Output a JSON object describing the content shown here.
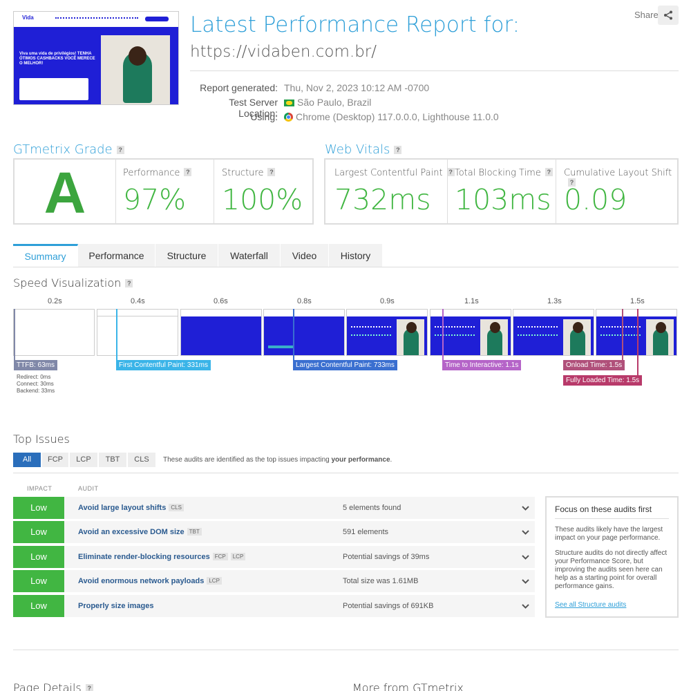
{
  "header": {
    "title": "Latest Performance Report for:",
    "url": "https://vidaben.com.br/",
    "share_label": "Share",
    "share_icon": "share-icon"
  },
  "thumbnail": {
    "logo": "Vida",
    "hero_text": "Viva uma vida de privilégios! TENHA ÓTIMOS CASHBACKS VOCÊ MERECE O MELHOR!"
  },
  "meta": {
    "report_generated_label": "Report generated:",
    "report_generated_value": "Thu, Nov 2, 2023 10:12 AM -0700",
    "test_server_label": "Test Server Location:",
    "test_server_value": "São Paulo, Brazil",
    "using_label": "Using:",
    "using_value": "Chrome (Desktop) 117.0.0.0, Lighthouse 11.0.0"
  },
  "grade": {
    "title": "GTmetrix Grade",
    "letter": "A",
    "performance_label": "Performance",
    "performance_value": "97%",
    "structure_label": "Structure",
    "structure_value": "100%"
  },
  "vitals": {
    "title": "Web Vitals",
    "lcp_label": "Largest Contentful Paint",
    "lcp_value": "732ms",
    "tbt_label": "Total Blocking Time",
    "tbt_value": "103ms",
    "cls_label": "Cumulative Layout Shift",
    "cls_value": "0.09"
  },
  "tabs": [
    "Summary",
    "Performance",
    "Structure",
    "Waterfall",
    "Video",
    "History"
  ],
  "speed": {
    "title": "Speed Visualization",
    "ticks": [
      "0.2s",
      "0.4s",
      "0.6s",
      "0.8s",
      "0.9s",
      "1.1s",
      "1.3s",
      "1.5s"
    ],
    "markers": {
      "ttfb": "TTFB: 63ms",
      "redirect": "Redirect: 0ms",
      "connect": "Connect: 30ms",
      "backend": "Backend: 33ms",
      "fcp": "First Contentful Paint: 331ms",
      "lcp": "Largest Contentful Paint: 733ms",
      "tti": "Time to Interactive: 1.1s",
      "onload": "Onload Time: 1.5s",
      "fully_loaded": "Fully Loaded Time: 1.5s"
    }
  },
  "issues": {
    "title": "Top Issues",
    "filters": [
      "All",
      "FCP",
      "LCP",
      "TBT",
      "CLS"
    ],
    "filter_note_prefix": "These audits are identified as the top issues impacting ",
    "filter_note_bold": "your performance",
    "filter_note_suffix": ".",
    "col_impact": "IMPACT",
    "col_audit": "AUDIT",
    "rows": [
      {
        "impact": "Low",
        "audit": "Avoid large layout shifts",
        "tags": [
          "CLS"
        ],
        "detail": "5 elements found"
      },
      {
        "impact": "Low",
        "audit": "Avoid an excessive DOM size",
        "tags": [
          "TBT"
        ],
        "detail": "591 elements"
      },
      {
        "impact": "Low",
        "audit": "Eliminate render-blocking resources",
        "tags": [
          "FCP",
          "LCP"
        ],
        "detail": "Potential savings of 39ms"
      },
      {
        "impact": "Low",
        "audit": "Avoid enormous network payloads",
        "tags": [
          "LCP"
        ],
        "detail": "Total size was 1.61MB"
      },
      {
        "impact": "Low",
        "audit": "Properly size images",
        "tags": [],
        "detail": "Potential savings of 691KB"
      }
    ],
    "focus": {
      "title": "Focus on these audits first",
      "p1": "These audits likely have the largest impact on your page performance.",
      "p2": "Structure audits do not directly affect your Performance Score, but improving the audits seen here can help as a starting point for overall performance gains.",
      "link": "See all Structure audits"
    }
  },
  "footer": {
    "page_details": "Page Details",
    "more_from": "More from GTmetrix"
  },
  "colors": {
    "accent": "#2e9fd8",
    "grade_green": "#41b642",
    "ttfb": "#8088a8",
    "fcp": "#3ab4e8",
    "lcp": "#3a6fd0",
    "tti": "#b564c8",
    "onload": "#b0507a",
    "fully_loaded": "#b83a6a"
  }
}
